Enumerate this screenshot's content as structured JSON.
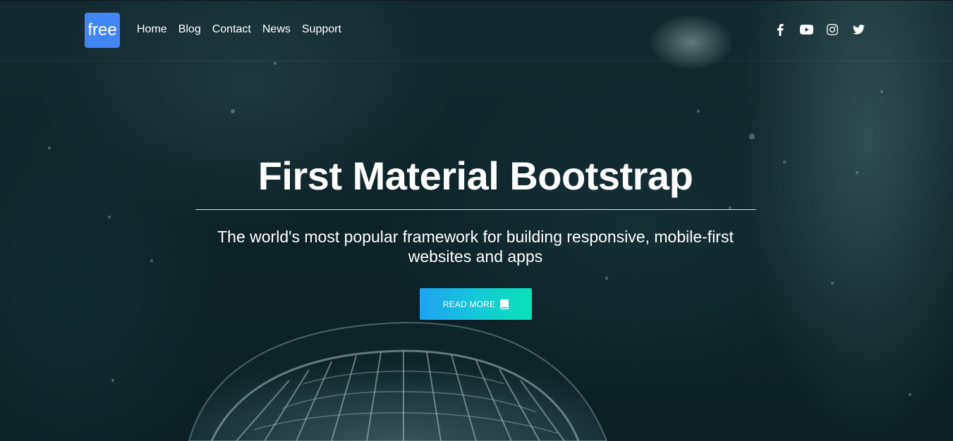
{
  "navbar": {
    "brand": "free",
    "links": [
      {
        "label": "Home"
      },
      {
        "label": "Blog"
      },
      {
        "label": "Contact"
      },
      {
        "label": "News"
      },
      {
        "label": "Support"
      }
    ],
    "social_icons": [
      "facebook-icon",
      "youtube-icon",
      "instagram-icon",
      "twitter-icon"
    ]
  },
  "hero": {
    "title": "First Material Bootstrap",
    "subtitle": "The world's most popular framework for building responsive, mobile-first websites and apps",
    "button_label": "READ MORE",
    "button_icon": "book-icon"
  },
  "colors": {
    "brand_badge": "#4285f4",
    "button_gradient_start": "#1ea1f2",
    "button_gradient_end": "#0ae2b4",
    "background": "#0f2429"
  }
}
